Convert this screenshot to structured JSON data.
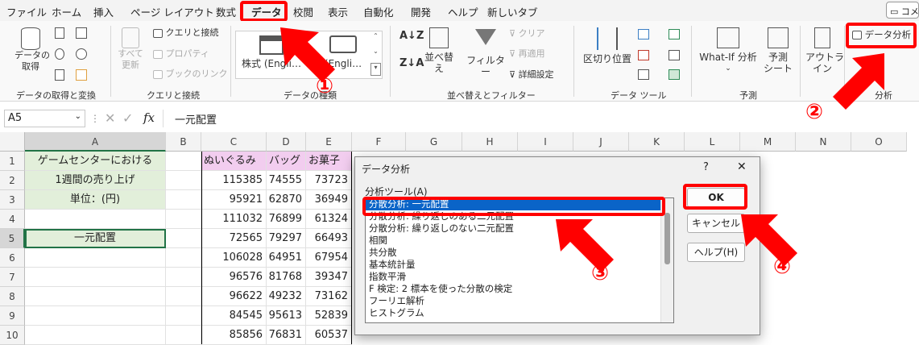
{
  "tabs": [
    "ファイル",
    "ホーム",
    "挿入",
    "ページ レイアウト",
    "数式",
    "データ",
    "校閲",
    "表示",
    "自動化",
    "開発",
    "ヘルプ",
    "新しいタブ"
  ],
  "comment_label": "コメ",
  "ribbon": {
    "get_data": "データの\n取得",
    "refresh_all": "すべて\n更新",
    "queries": "クエリと接続",
    "properties": "プロパティ",
    "edit_links": "ブックのリンク",
    "stocks": "株式 (Engli…",
    "currencies": "(Engli…",
    "sort_asc": "A↓Z",
    "sort_desc": "Z↓A",
    "sort": "並べ替え",
    "filter": "フィルター",
    "clear": "クリア",
    "reapply": "再適用",
    "advanced": "詳細設定",
    "text_to_columns": "区切り位置",
    "whatif": "What-If 分析",
    "forecast": "予測\nシート",
    "outline": "アウトラ\nイン",
    "data_analysis": "データ分析",
    "groups": {
      "get": "データの取得と変換",
      "queries": "クエリと接続",
      "types": "データの種類",
      "sort": "並べ替えとフィルター",
      "tools": "データ ツール",
      "forecast": "予測",
      "analysis": "分析"
    }
  },
  "namebox": "A5",
  "formula": "一元配置",
  "columns": [
    "A",
    "B",
    "C",
    "D",
    "E",
    "F",
    "G",
    "H",
    "I",
    "J",
    "K",
    "L",
    "M",
    "N",
    "O"
  ],
  "rows": [
    "1",
    "2",
    "3",
    "4",
    "5",
    "6",
    "7",
    "8",
    "9",
    "10"
  ],
  "a_cells": [
    "ゲームセンターにおける",
    "1週間の売り上げ",
    "単位：(円)",
    "",
    "一元配置"
  ],
  "headers": [
    "ぬいぐるみ",
    "バッグ",
    "お菓子"
  ],
  "data": [
    [
      "115385",
      "74555",
      "73723"
    ],
    [
      "95921",
      "62870",
      "36949"
    ],
    [
      "111032",
      "76899",
      "61324"
    ],
    [
      "72565",
      "79297",
      "66493"
    ],
    [
      "106028",
      "64951",
      "67954"
    ],
    [
      "96576",
      "81768",
      "39347"
    ],
    [
      "96622",
      "49232",
      "73162"
    ],
    [
      "84545",
      "95613",
      "52839"
    ],
    [
      "85856",
      "76831",
      "60537"
    ]
  ],
  "dialog": {
    "title": "データ分析",
    "help_q": "?",
    "close": "✕",
    "list_label": "分析ツール(A)",
    "items": [
      "分散分析: 一元配置",
      "分散分析: 繰り返しのある二元配置",
      "分散分析: 繰り返しのない二元配置",
      "相関",
      "共分散",
      "基本統計量",
      "指数平滑",
      "F 検定: 2 標本を使った分散の検定",
      "フーリエ解析",
      "ヒストグラム"
    ],
    "ok": "OK",
    "cancel": "キャンセル",
    "help": "ヘルプ(H)"
  },
  "annotations": [
    "①",
    "②",
    "③",
    "④"
  ],
  "colors": {
    "accent_red": "#ff0000",
    "selected": "#0a64c8",
    "pink": "#f2cdef",
    "green": "#e2efda"
  }
}
